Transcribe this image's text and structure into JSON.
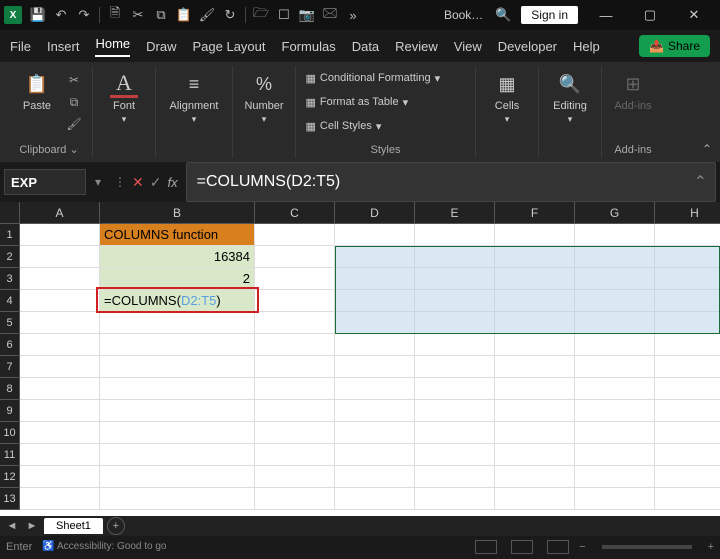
{
  "titlebar": {
    "app_letter": "X",
    "doc_name": "Book…",
    "sign_in": "Sign in",
    "qat_icons": [
      "save-icon",
      "undo-icon",
      "redo-icon",
      "new-icon",
      "copy-icon",
      "cut-icon",
      "paste-icon",
      "format-painter-icon",
      "print-icon",
      "repeat-icon",
      "open-icon",
      "touch-icon",
      "email-icon",
      "properties-icon",
      "more-icon"
    ]
  },
  "tabs": {
    "items": [
      "File",
      "Insert",
      "Home",
      "Draw",
      "Page Layout",
      "Formulas",
      "Data",
      "Review",
      "View",
      "Developer",
      "Help"
    ],
    "active_index": 2,
    "share": "Share"
  },
  "ribbon": {
    "clipboard": {
      "paste": "Paste",
      "label": "Clipboard"
    },
    "font": {
      "label": "Font"
    },
    "alignment": {
      "label": "Alignment"
    },
    "number": {
      "label": "Number"
    },
    "styles": {
      "cond_format": "Conditional Formatting",
      "as_table": "Format as Table",
      "cell_styles": "Cell Styles",
      "label": "Styles"
    },
    "cells": {
      "label": "Cells"
    },
    "editing": {
      "label": "Editing"
    },
    "addins": {
      "label": "Add-ins"
    }
  },
  "namebox": {
    "value": "EXP"
  },
  "formula_bar": {
    "prefix": "=COLUMNS(",
    "ref": "D2:T5",
    "suffix": ")"
  },
  "columns": [
    "A",
    "B",
    "C",
    "D",
    "E",
    "F",
    "G",
    "H"
  ],
  "rows": [
    "1",
    "2",
    "3",
    "4",
    "5",
    "6",
    "7",
    "8",
    "9",
    "10",
    "11",
    "12",
    "13"
  ],
  "cells": {
    "B1": "COLUMNS function",
    "B2": "16384",
    "B3": "2",
    "B4_prefix": "=COLUMNS(",
    "B4_ref": "D2:T5",
    "B4_suffix": ")"
  },
  "selection_range": "D2:T5",
  "sheet_tabs": {
    "active": "Sheet1"
  },
  "status": {
    "mode": "Enter",
    "accessibility": "Accessibility: Good to go"
  }
}
